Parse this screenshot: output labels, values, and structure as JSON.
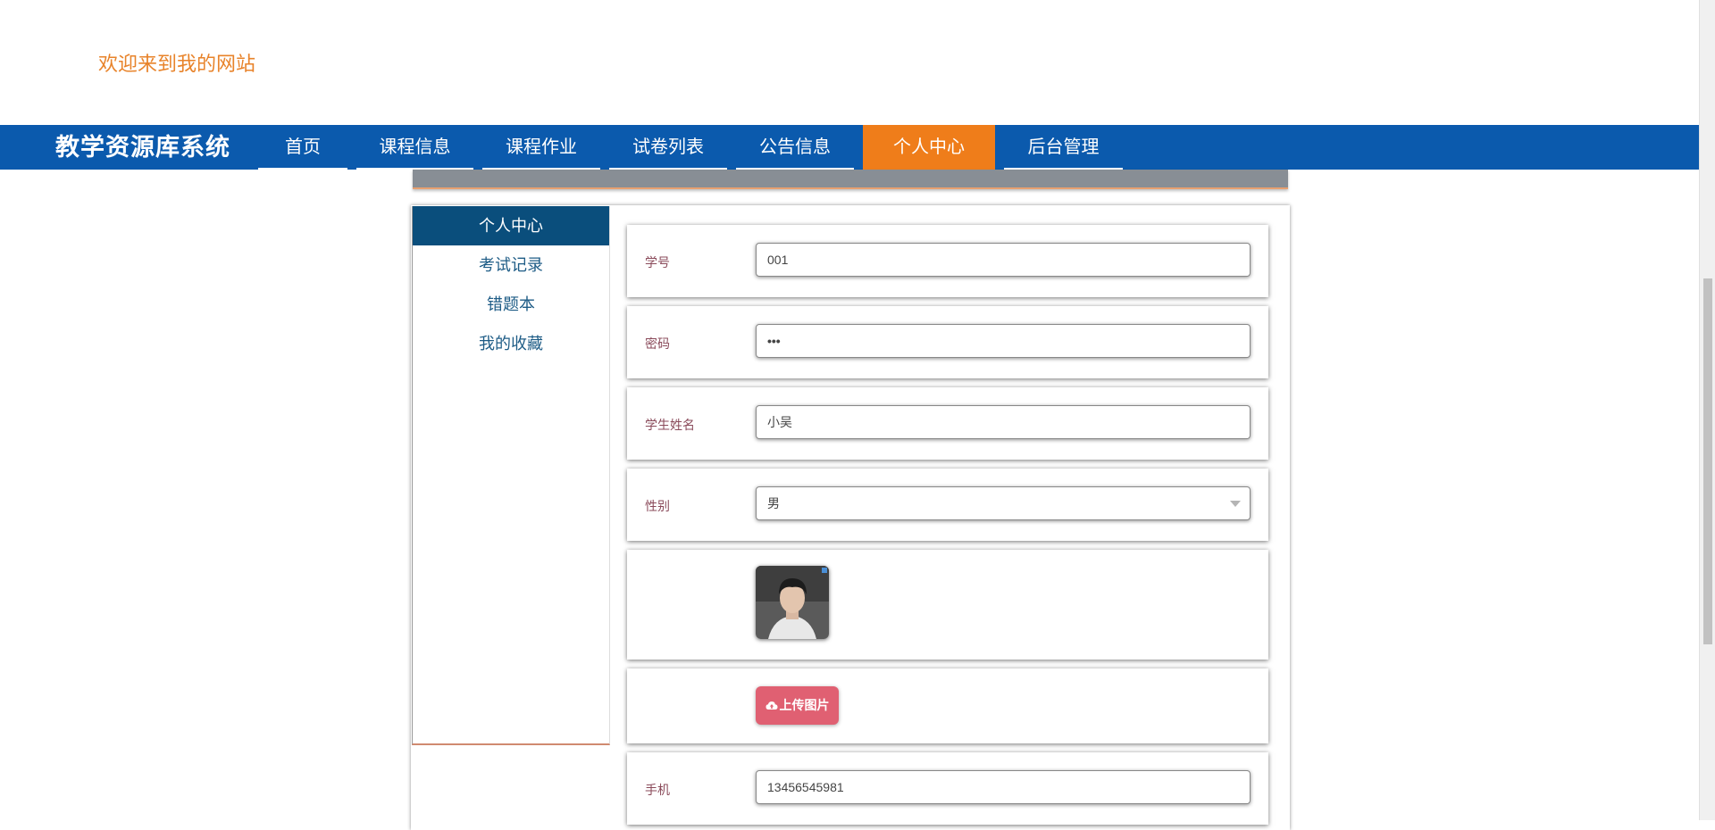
{
  "header": {
    "welcome": "欢迎来到我的网站"
  },
  "navbar": {
    "brand": "教学资源库系统",
    "items": [
      {
        "label": "首页"
      },
      {
        "label": "课程信息"
      },
      {
        "label": "课程作业"
      },
      {
        "label": "试卷列表"
      },
      {
        "label": "公告信息"
      },
      {
        "label": "个人中心",
        "active": true
      },
      {
        "label": "后台管理"
      }
    ]
  },
  "sidebar": {
    "items": [
      {
        "label": "个人中心",
        "active": true
      },
      {
        "label": "考试记录"
      },
      {
        "label": "错题本"
      },
      {
        "label": "我的收藏"
      }
    ]
  },
  "form": {
    "student_id": {
      "label": "学号",
      "value": "001"
    },
    "password": {
      "label": "密码",
      "value": "•••"
    },
    "student_name": {
      "label": "学生姓名",
      "value": "小吴"
    },
    "gender": {
      "label": "性别",
      "value": "男"
    },
    "upload": {
      "label": "上传图片"
    },
    "phone": {
      "label": "手机",
      "value": "13456545981"
    }
  },
  "colors": {
    "navbar": "#0b5aad",
    "nav_active": "#ef7d1a",
    "welcome_text": "#e8832a",
    "sidebar_active": "#0a4e7c",
    "upload_button": "#e06072"
  },
  "icons": {
    "upload": "cloud-upload-icon",
    "select": "chevron-down-icon"
  }
}
